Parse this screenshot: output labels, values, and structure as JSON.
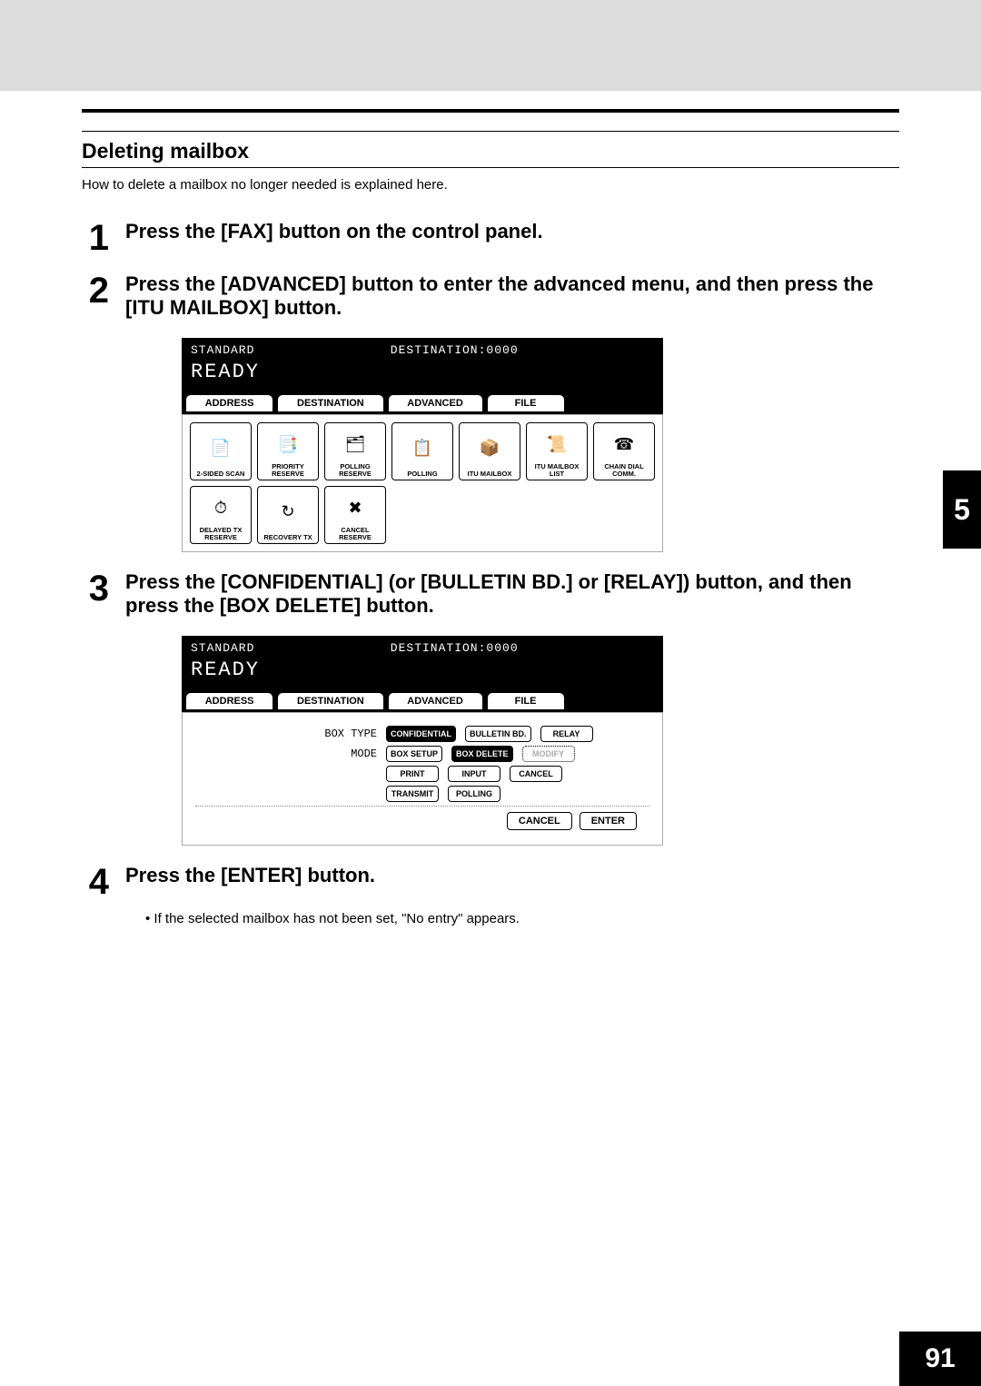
{
  "chapter": "5",
  "page_number": "91",
  "section": {
    "title": "Deleting mailbox",
    "intro": "How to delete a mailbox no longer needed is explained here."
  },
  "steps": {
    "s1": {
      "n": "1",
      "t": "Press the [FAX] button on the control panel."
    },
    "s2": {
      "n": "2",
      "t": "Press the [ADVANCED] button to enter the advanced menu, and then press the [ITU MAILBOX] button."
    },
    "s3": {
      "n": "3",
      "t": "Press the [CONFIDENTIAL] (or [BULLETIN BD.] or [RELAY]) button, and then press the [BOX DELETE] button."
    },
    "s4": {
      "n": "4",
      "t": "Press the [ENTER] button.",
      "note": "If the selected mailbox has not been set, \"No entry\" appears."
    }
  },
  "screen1": {
    "std": "STANDARD",
    "dest": "DESTINATION:0000",
    "ready": "READY",
    "tabs": {
      "t1": "ADDRESS",
      "t2": "DESTINATION",
      "t3": "ADVANCED",
      "t4": "FILE"
    },
    "cells": {
      "c1": "2-SIDED SCAN",
      "c2": "PRIORITY RESERVE",
      "c3": "POLLING RESERVE",
      "c4": "POLLING",
      "c5": "ITU MAILBOX",
      "c6": "ITU MAILBOX LIST",
      "c7": "CHAIN DIAL COMM.",
      "c8": "DELAYED TX RESERVE",
      "c9": "RECOVERY TX",
      "c10": "CANCEL RESERVE"
    }
  },
  "screen2": {
    "std": "STANDARD",
    "dest": "DESTINATION:0000",
    "ready": "READY",
    "tabs": {
      "t1": "ADDRESS",
      "t2": "DESTINATION",
      "t3": "ADVANCED",
      "t4": "FILE"
    },
    "row1": {
      "lbl": "BOX TYPE",
      "b1": "CONFIDENTIAL",
      "b2": "BULLETIN BD.",
      "b3": "RELAY"
    },
    "row2": {
      "lbl": "MODE",
      "b1": "BOX SETUP",
      "b2": "BOX DELETE",
      "b3": "MODIFY"
    },
    "row3": {
      "b1": "PRINT",
      "b2": "INPUT",
      "b3": "CANCEL"
    },
    "row4": {
      "b1": "TRANSMIT",
      "b2": "POLLING"
    },
    "footer": {
      "cancel": "CANCEL",
      "enter": "ENTER"
    }
  }
}
